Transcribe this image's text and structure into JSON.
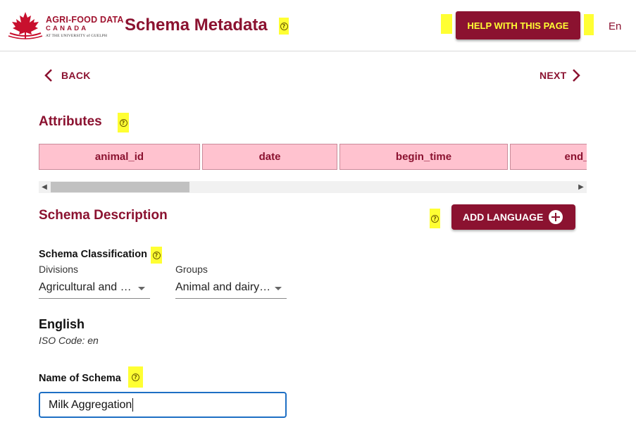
{
  "header": {
    "logo": {
      "line1": "AGRI-FOOD DATA",
      "line2": "CANADA",
      "line3": "AT THE UNIVERSITY of GUELPH"
    },
    "title": "Schema Metadata",
    "help_button": "HELP WITH THIS PAGE",
    "language": "En"
  },
  "nav": {
    "back": "BACK",
    "next": "NEXT"
  },
  "attributes": {
    "title": "Attributes",
    "columns": [
      "animal_id",
      "date",
      "begin_time",
      "end_"
    ]
  },
  "schema_description": {
    "title": "Schema Description",
    "add_language": "ADD LANGUAGE"
  },
  "classification": {
    "title": "Schema Classification",
    "divisions_label": "Divisions",
    "divisions_value": "Agricultural and v…",
    "groups_label": "Groups",
    "groups_value": "Animal and dairy …"
  },
  "language_section": {
    "heading": "English",
    "iso": "ISO Code: en"
  },
  "name_field": {
    "label": "Name of Schema",
    "value": "Milk Aggregation"
  },
  "colors": {
    "brand": "#8b1230",
    "attribute_fill": "#ffc2cf",
    "highlight": "#ffff33",
    "focus": "#1e6fc4"
  },
  "icons": [
    "maple-leaf-logo-icon",
    "help-circle-icon",
    "chevron-left-icon",
    "chevron-right-icon",
    "add-circle-icon"
  ]
}
